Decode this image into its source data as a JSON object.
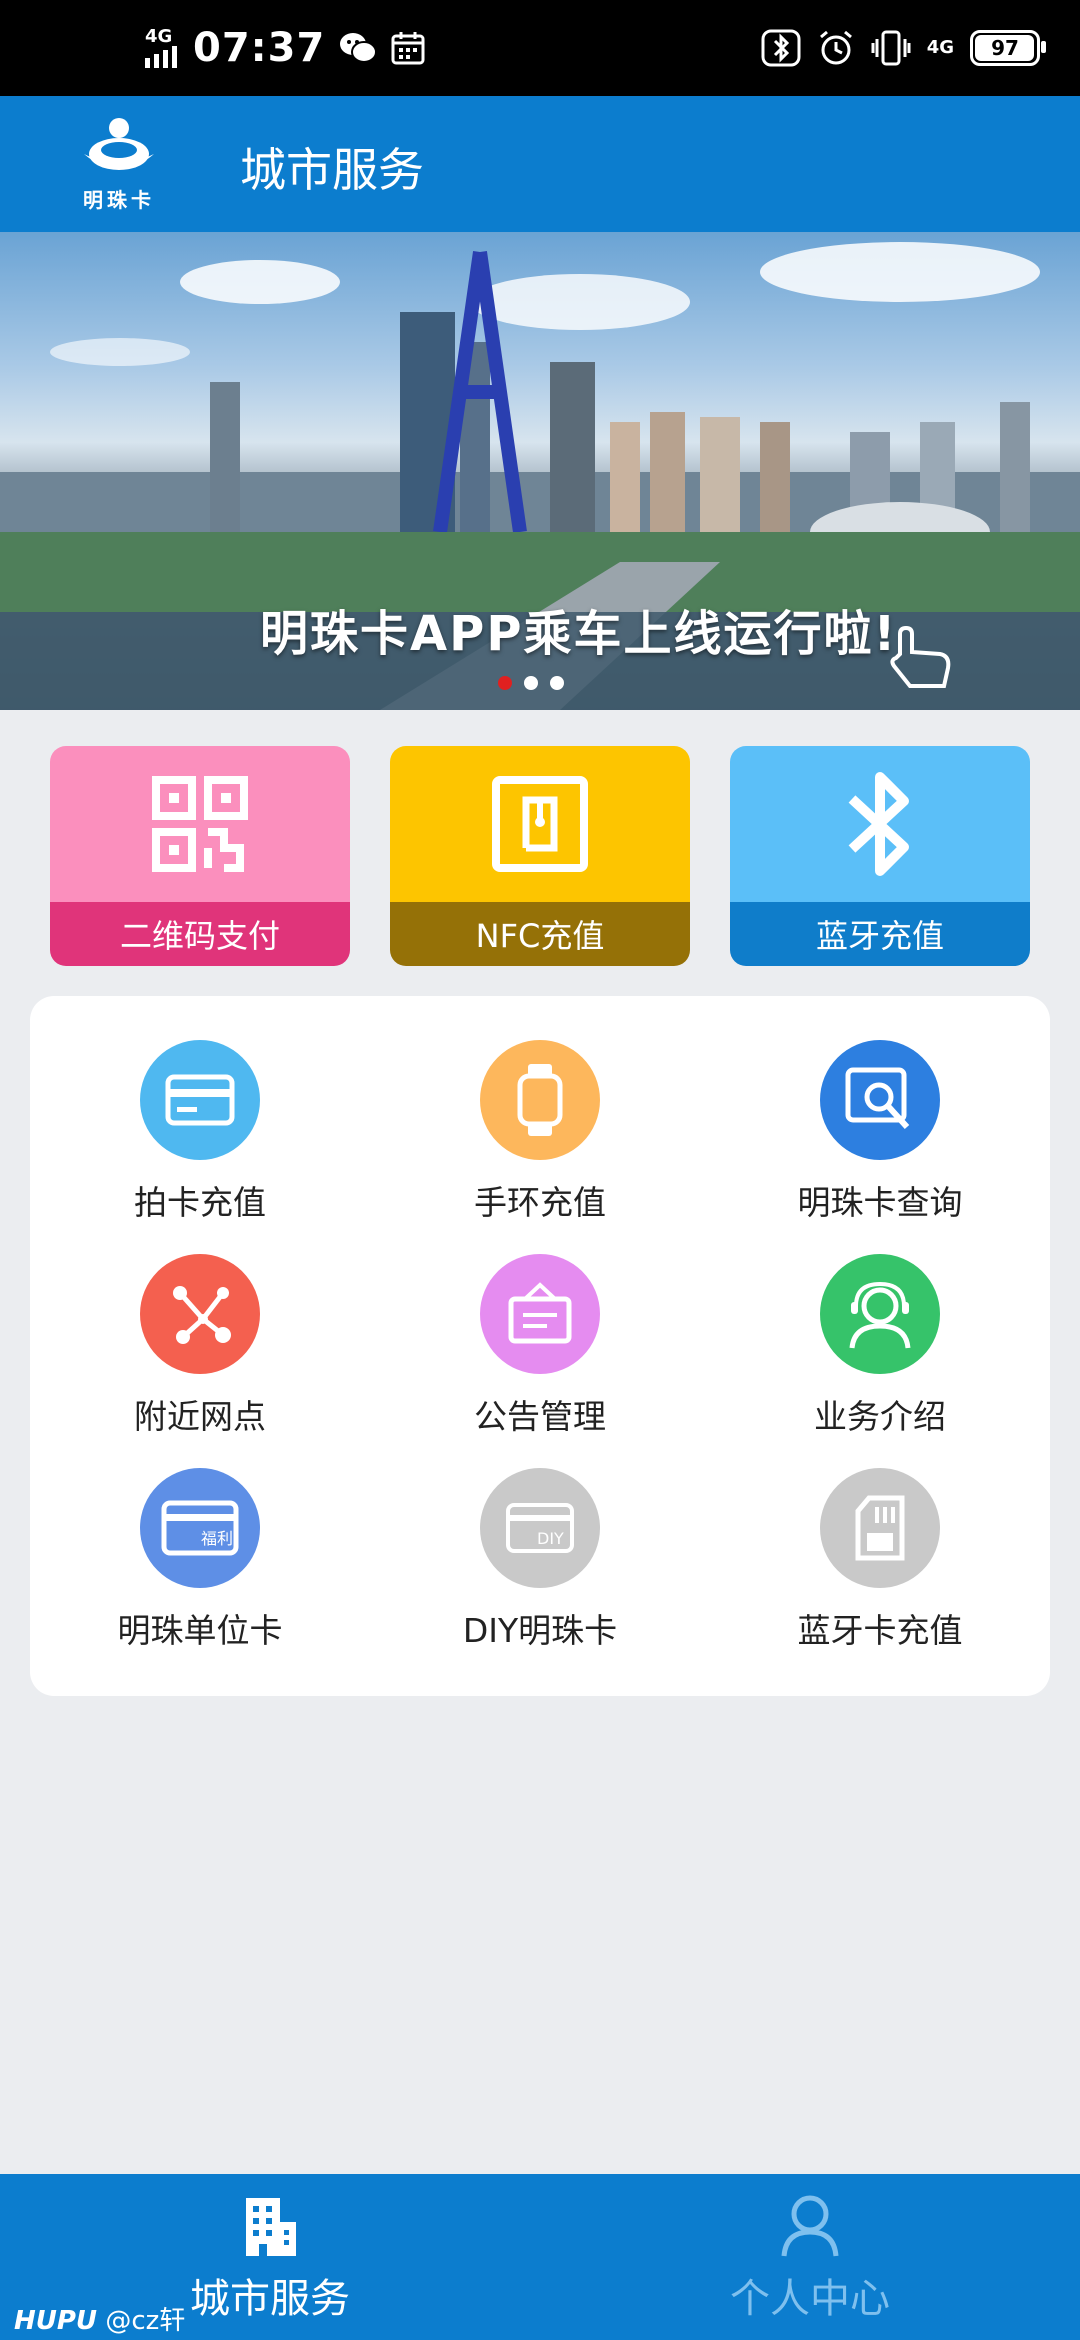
{
  "status_bar": {
    "time": "07:37",
    "network_left": "4G",
    "network_right": "4G",
    "battery": "97"
  },
  "header": {
    "logo_text": "明珠卡",
    "title": "城市服务"
  },
  "banner": {
    "caption": "明珠卡APP乘车上线运行啦!",
    "slide_count": 3,
    "active_slide": 1
  },
  "quick_tiles": [
    {
      "label": "二维码支付",
      "icon": "qr-code-icon"
    },
    {
      "label": "NFC充值",
      "icon": "nfc-icon"
    },
    {
      "label": "蓝牙充值",
      "icon": "bluetooth-icon"
    }
  ],
  "services": [
    {
      "label": "拍卡充值",
      "icon": "card-icon",
      "color": "#4fb8f0"
    },
    {
      "label": "手环充值",
      "icon": "watch-icon",
      "color": "#fdb75c"
    },
    {
      "label": "明珠卡查询",
      "icon": "search-card-icon",
      "color": "#2d7fe0"
    },
    {
      "label": "附近网点",
      "icon": "share-nodes-icon",
      "color": "#f4604f"
    },
    {
      "label": "公告管理",
      "icon": "notice-board-icon",
      "color": "#e58cf0"
    },
    {
      "label": "业务介绍",
      "icon": "customer-service-icon",
      "color": "#36c36a"
    },
    {
      "label": "明珠单位卡",
      "icon": "welfare-card-icon",
      "color": "#5e8fe6",
      "card_text": "福利"
    },
    {
      "label": "DIY明珠卡",
      "icon": "diy-card-icon",
      "color": "#c9c9c9",
      "card_text": "DIY"
    },
    {
      "label": "蓝牙卡充值",
      "icon": "sim-card-icon",
      "color": "#c9c9c9"
    }
  ],
  "bottom_nav": [
    {
      "label": "城市服务",
      "icon": "building-icon",
      "active": true
    },
    {
      "label": "个人中心",
      "icon": "person-icon",
      "active": false
    }
  ],
  "watermark": {
    "brand": "HUPU",
    "user": "@cz轩"
  }
}
